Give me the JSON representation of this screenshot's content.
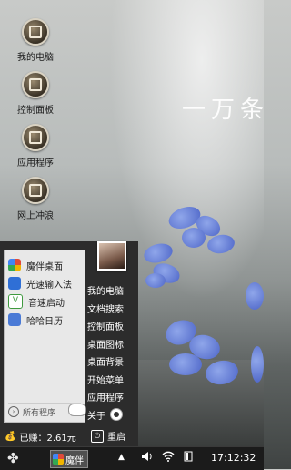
{
  "wallpaper": {
    "text": "一万条"
  },
  "desktop": {
    "icons": [
      {
        "label": "我的电脑",
        "icon": "computer-icon"
      },
      {
        "label": "控制面板",
        "icon": "control-panel-icon"
      },
      {
        "label": "应用程序",
        "icon": "apps-icon"
      },
      {
        "label": "网上冲浪",
        "icon": "globe-icon"
      }
    ]
  },
  "start_menu": {
    "apps": [
      {
        "label": "魔伴桌面",
        "color": "#e24a3b"
      },
      {
        "label": "光速输入法",
        "color": "#2f6fd6"
      },
      {
        "label": "音速启动",
        "color": "#3f9a3f"
      },
      {
        "label": "哈哈日历",
        "color": "#4a7ad6"
      }
    ],
    "all_programs": "所有程序",
    "links": [
      "我的电脑",
      "文档搜索",
      "控制面板",
      "桌面图标",
      "桌面背景",
      "开始菜单",
      "应用程序",
      "关于"
    ],
    "earned": "已赚：2.61元",
    "restart": "重启"
  },
  "taskbar": {
    "start_icon": "✤",
    "active_app": "魔伴",
    "tray_arrow": "▲",
    "clock": "17:12:32"
  }
}
